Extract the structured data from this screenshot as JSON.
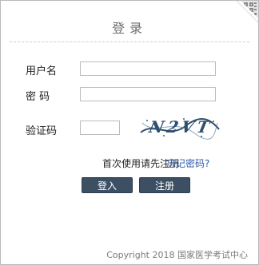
{
  "header": {
    "title": "登录",
    "qr_icon": "qr-code-corner-icon"
  },
  "form": {
    "username_label": "用户名",
    "username_value": "",
    "username_placeholder": "",
    "password_label": "密 码",
    "password_value": "",
    "password_placeholder": "",
    "captcha_label": "验证码",
    "captcha_value": "",
    "captcha_placeholder": "",
    "captcha_image_text": "N2VT"
  },
  "links": {
    "first_use_text": "首次使用请先注册",
    "forgot_password": "忘记密码?"
  },
  "buttons": {
    "login": "登入",
    "register": "注册"
  },
  "footer": {
    "copyright": "Copyright 2018 国家医学考试中心"
  },
  "colors": {
    "button_bg": "#3c4f63",
    "link": "#2a5aa6",
    "title": "#6e6e6e"
  }
}
